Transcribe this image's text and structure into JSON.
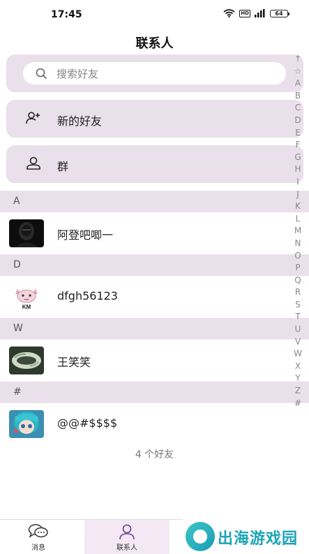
{
  "status_bar": {
    "time": "17:45",
    "hd": "HD",
    "battery": "64"
  },
  "header": {
    "title": "联系人"
  },
  "search": {
    "placeholder": "搜索好友"
  },
  "menu": [
    {
      "label": "新的好友",
      "icon": "add-user-icon"
    },
    {
      "label": "群",
      "icon": "user-icon"
    }
  ],
  "sections": [
    {
      "letter": "A",
      "contacts": [
        {
          "name": "阿登吧唧一",
          "avatar": "dark-hooded-figure"
        }
      ]
    },
    {
      "letter": "D",
      "contacts": [
        {
          "name": "dfgh56123",
          "avatar": "pink-cat-km",
          "avatar_text": "KM"
        }
      ]
    },
    {
      "letter": "W",
      "contacts": [
        {
          "name": "王笑笑",
          "avatar": "jade-bracelet"
        }
      ]
    },
    {
      "letter": "#",
      "contacts": [
        {
          "name": "@@#$$$$",
          "avatar": "anime-girl-teal-hair"
        }
      ]
    }
  ],
  "friend_count": "4 个好友",
  "index_letters": [
    "↑",
    "☆",
    "A",
    "B",
    "C",
    "D",
    "E",
    "F",
    "G",
    "H",
    "I",
    "J",
    "K",
    "L",
    "M",
    "N",
    "O",
    "P",
    "Q",
    "R",
    "S",
    "T",
    "U",
    "V",
    "W",
    "X",
    "Y",
    "Z",
    "#"
  ],
  "bottom_nav": [
    {
      "label": "消息",
      "icon": "chat-bubbles-icon",
      "active": false
    },
    {
      "label": "联系人",
      "icon": "person-icon",
      "active": true
    }
  ],
  "watermark": {
    "text": "出海游戏园"
  },
  "colors": {
    "accent_bg": "#eae0eb",
    "active_nav": "#f3e8f4",
    "watermark": "#1aa4b6"
  }
}
